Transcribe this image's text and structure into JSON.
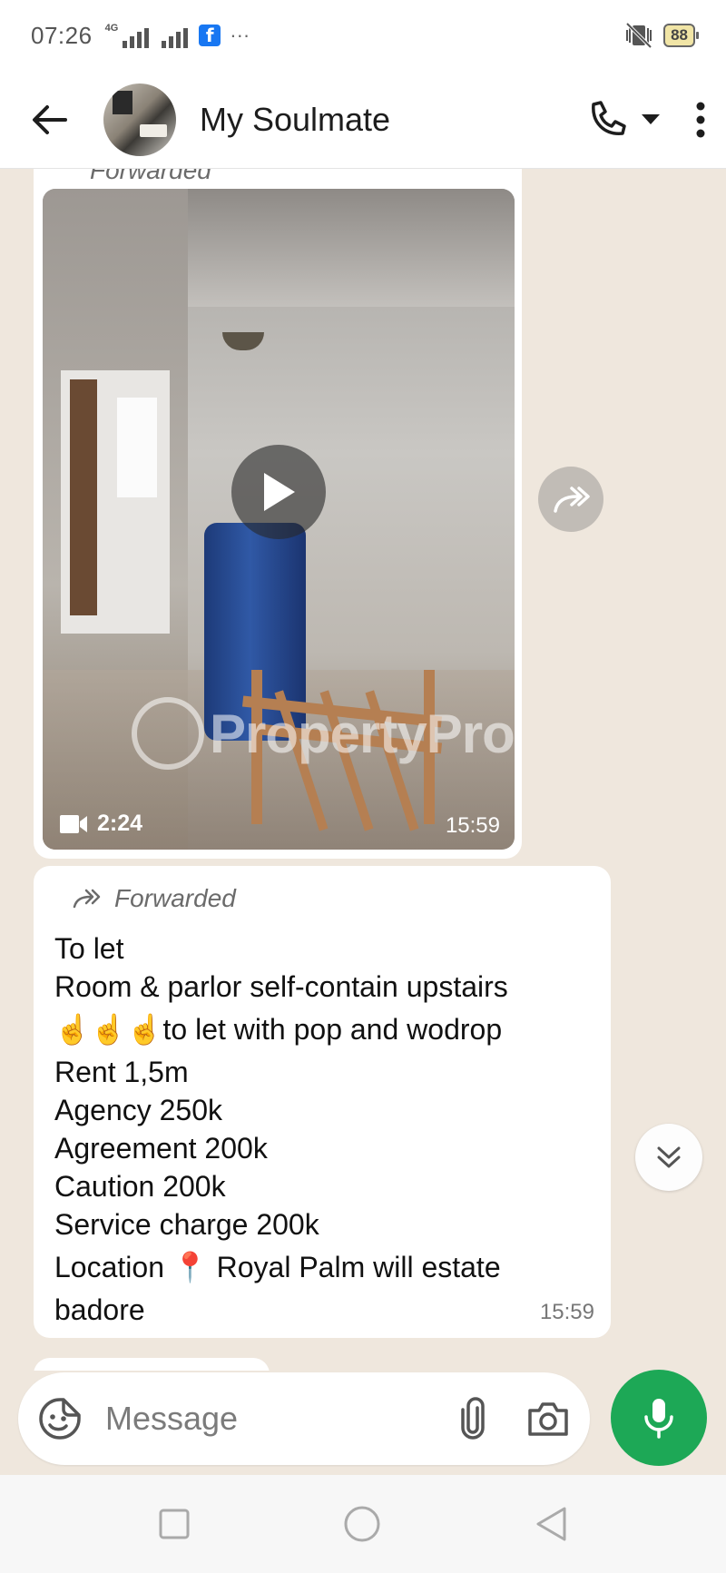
{
  "status_bar": {
    "time": "07:26",
    "network": "4G",
    "app_badge": "f",
    "more": "···",
    "battery": "88"
  },
  "header": {
    "contact_name": "My Soulmate"
  },
  "video_message": {
    "forwarded_label": "Forwarded",
    "duration": "2:24",
    "timestamp": "15:59",
    "watermark": "PropertyPro"
  },
  "text_message": {
    "forwarded_label": "Forwarded",
    "lines": [
      "To let",
      "Room & parlor self-contain upstairs",
      "☝️☝️☝️to let with pop and wodrop",
      "Rent 1,5m",
      "Agency 250k",
      "Agreement 200k",
      "Caution 200k",
      "Service charge 200k",
      "Location 📍 Royal Palm will estate",
      "badore"
    ],
    "timestamp": "15:59"
  },
  "composer": {
    "placeholder": "Message"
  },
  "colors": {
    "accent": "#1da856",
    "chat_bg": "#efe7dd",
    "bubble": "#ffffff"
  }
}
